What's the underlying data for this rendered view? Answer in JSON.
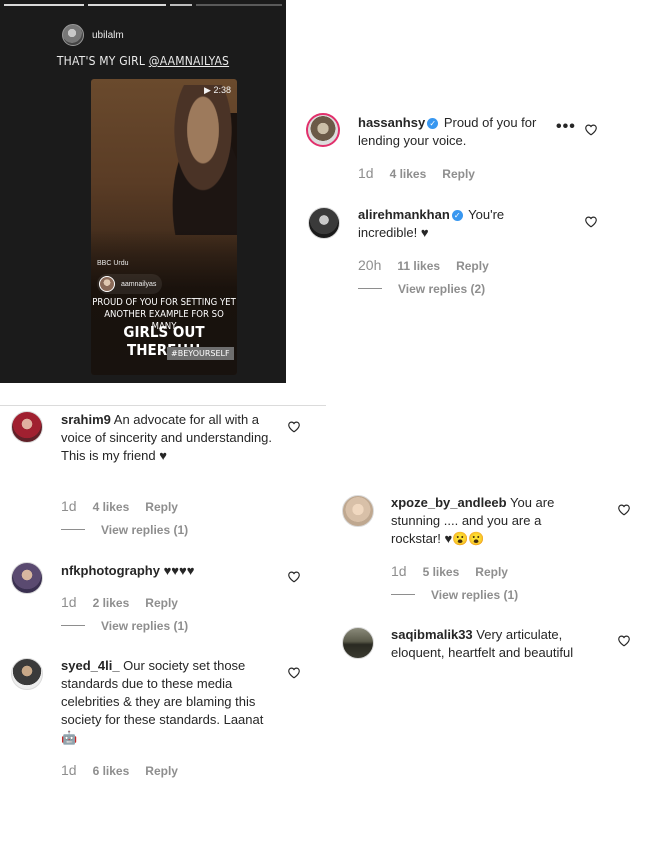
{
  "story": {
    "username": "ubilalm",
    "caption_prefix": "THAT'S MY GIRL ",
    "caption_mention": "@AAMNAILYAS",
    "video_duration": "2:38",
    "source": "BBC Urdu",
    "mention_user": "aamnailyas",
    "text_line1": "PROUD OF YOU FOR SETTING YET ANOTHER EXAMPLE FOR SO MANY",
    "text_line2": "GIRLS OUT THERE!!!!",
    "hashtag": "#BEYOURSELF"
  },
  "comments": [
    {
      "user": "hassanhsy",
      "verified": true,
      "text": "Proud of you for lending your voice.",
      "time": "1d",
      "likes": "4 likes",
      "reply": "Reply",
      "more": "•••"
    },
    {
      "user": "alirehmankhan",
      "verified": true,
      "text": "You're incredible! ♥",
      "time": "20h",
      "likes": "11 likes",
      "reply": "Reply",
      "view_replies": "View replies (2)"
    },
    {
      "user": "srahim9",
      "text": "An advocate for all with a voice of sincerity and understanding. This is my friend ♥",
      "time": "1d",
      "likes": "4 likes",
      "reply": "Reply",
      "view_replies": "View replies (1)"
    },
    {
      "user": "nfkphotography",
      "text": "♥♥♥♥",
      "time": "1d",
      "likes": "2 likes",
      "reply": "Reply",
      "view_replies": "View replies (1)"
    },
    {
      "user": "syed_4li_",
      "text": "Our society set those standards due to these media celebrities & they are blaming this society for these standards. Laanat🤖",
      "time": "1d",
      "likes": "6 likes",
      "reply": "Reply"
    },
    {
      "user": "xpoze_by_andleeb",
      "text": "You are stunning .... and you are a rockstar! ♥😮😮",
      "time": "1d",
      "likes": "5 likes",
      "reply": "Reply",
      "view_replies": "View replies (1)"
    },
    {
      "user": "saqibmalik33",
      "text": "Very articulate, eloquent, heartfelt and beautiful"
    }
  ],
  "colors": {
    "story_bg": "#1b1b1b",
    "verified": "#3897f0",
    "meta": "#8e8e8e",
    "text": "#262626"
  },
  "icons": [
    "heart-outline-icon",
    "verified-badge-icon",
    "more-options-icon",
    "play-icon"
  ]
}
